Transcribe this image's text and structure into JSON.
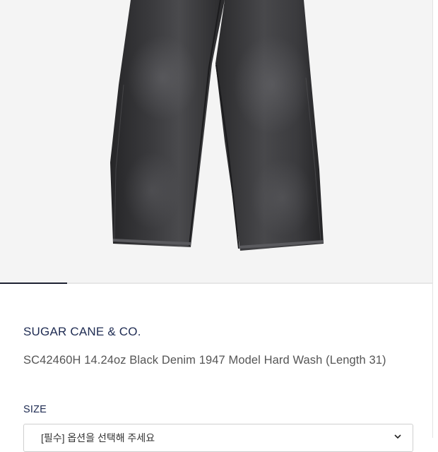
{
  "product": {
    "brand": "SUGAR CANE & CO.",
    "title": "SC42460H 14.24oz Black Denim 1947 Model Hard Wash (Length 31)"
  },
  "gallery": {
    "image_alt": "black denim jeans",
    "progress": 0.156
  },
  "size_selector": {
    "label": "SIZE",
    "selected_value": "[필수] 옵션을 선택해 주세요",
    "icon": "chevron-down-icon"
  },
  "colors": {
    "brand": "#1e2b52",
    "denim": "#2c2c2e",
    "gallery_bg": "#f4f4f4"
  }
}
